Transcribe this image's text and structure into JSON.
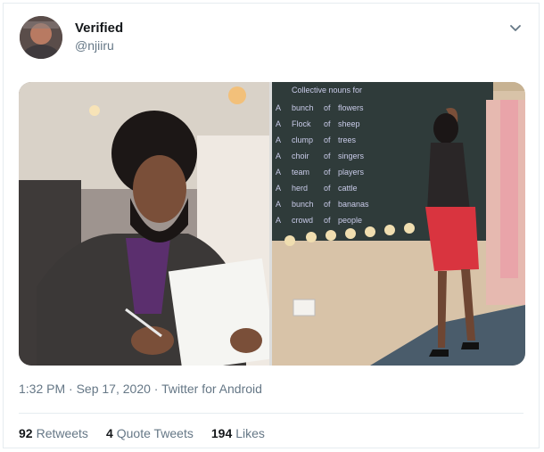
{
  "author": {
    "display_name": "Verified",
    "handle": "@njiiru"
  },
  "icons": {
    "menu": "chevron-down-icon"
  },
  "meta": {
    "time": "1:32 PM",
    "separator1": " · ",
    "date": "Sep 17, 2020",
    "separator2": " · ",
    "source": "Twitter for Android"
  },
  "stats": {
    "retweets_count": "92",
    "retweets_label": "Retweets",
    "quote_count": "4",
    "quote_label": "Quote Tweets",
    "likes_count": "194",
    "likes_label": "Likes"
  },
  "chalkboard_text": {
    "title": "Collective nouns for",
    "rows": [
      {
        "article": "A",
        "noun": "bunch",
        "of": "of",
        "item": "flowers"
      },
      {
        "article": "A",
        "noun": "Flock",
        "of": "of",
        "item": "sheep"
      },
      {
        "article": "A",
        "noun": "clump",
        "of": "of",
        "item": "trees"
      },
      {
        "article": "A",
        "noun": "choir",
        "of": "of",
        "item": "singers"
      },
      {
        "article": "A",
        "noun": "team",
        "of": "of",
        "item": "players"
      },
      {
        "article": "A",
        "noun": "herd",
        "of": "of",
        "item": "cattle"
      },
      {
        "article": "A",
        "noun": "bunch",
        "of": "of",
        "item": "bananas"
      },
      {
        "article": "A",
        "noun": "crowd",
        "of": "of",
        "item": "people"
      }
    ]
  },
  "colors": {
    "accent": "#1da1f2",
    "text_primary": "#14171a",
    "text_secondary": "#657786",
    "border": "#e6ecf0",
    "chalkboard": "#2f3b3a",
    "skirt": "#d9343f"
  }
}
